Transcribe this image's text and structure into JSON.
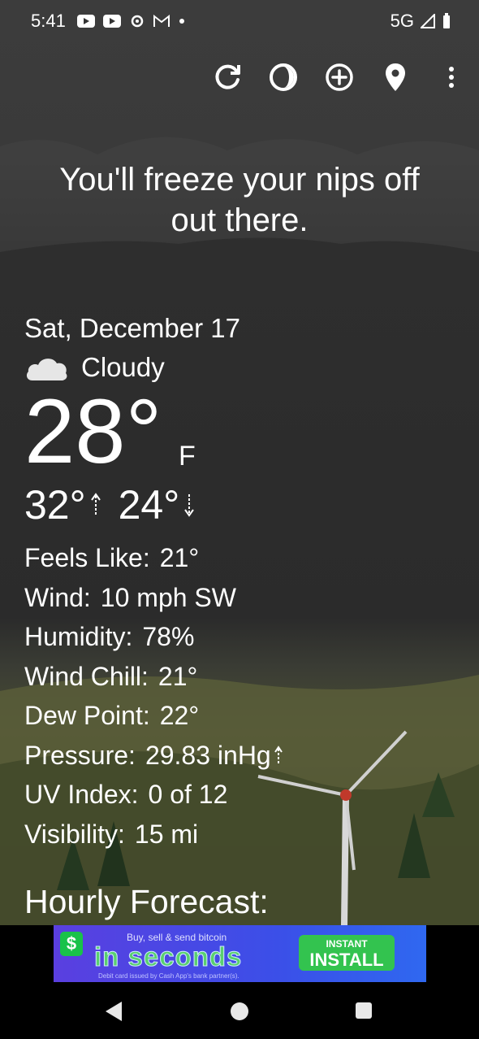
{
  "status_bar": {
    "time": "5:41",
    "network": "5G",
    "left_icons": [
      "youtube-icon",
      "youtube-icon",
      "settings-icon",
      "gmail-icon",
      "dot-icon"
    ],
    "right_icons": [
      "signal-icon",
      "battery-icon"
    ]
  },
  "toolbar": {
    "actions": [
      "refresh-icon",
      "theme-icon",
      "add-location-icon",
      "location-pin-icon",
      "more-vert-icon"
    ]
  },
  "headline": "You'll freeze your nips off out there.",
  "current": {
    "date": "Sat, December 17",
    "condition": "Cloudy",
    "condition_icon": "cloud-icon",
    "temperature": "28°",
    "unit": "F",
    "high": "32°",
    "low": "24°"
  },
  "details": [
    {
      "label": "Feels Like:",
      "value": "21°"
    },
    {
      "label": "Wind:",
      "value": "10 mph SW"
    },
    {
      "label": "Humidity:",
      "value": "78%"
    },
    {
      "label": "Wind Chill:",
      "value": "21°"
    },
    {
      "label": "Dew Point:",
      "value": "22°"
    },
    {
      "label": "Pressure:",
      "value": "29.83 inHg",
      "trend": "up"
    },
    {
      "label": "UV Index:",
      "value": "0 of 12"
    },
    {
      "label": "Visibility:",
      "value": "15 mi"
    }
  ],
  "hourly_title": "Hourly Forecast:",
  "ad": {
    "top_line": "Buy, sell & send bitcoin",
    "headline": "in seconds",
    "fine_print": "Debit card issued by Cash App's bank partner(s).",
    "button_top": "INSTANT",
    "button_main": "INSTALL",
    "brand_symbol": "$"
  },
  "colors": {
    "text": "#ffffff",
    "ad_background": "#4a46e6",
    "ad_button": "#33c34f"
  }
}
